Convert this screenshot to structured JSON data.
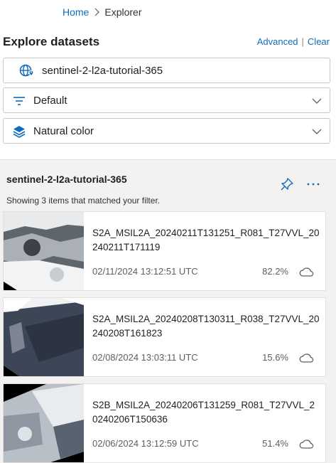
{
  "breadcrumb": {
    "home": "Home",
    "current": "Explorer"
  },
  "header": {
    "title": "Explore datasets",
    "advanced": "Advanced",
    "clear": "Clear"
  },
  "fields": {
    "dataset": {
      "value": "sentinel-2-l2a-tutorial-365",
      "icon": "globe-icon"
    },
    "filter": {
      "value": "Default",
      "icon": "filter-icon"
    },
    "render": {
      "value": "Natural color",
      "icon": "layers-icon"
    }
  },
  "results": {
    "collection": "sentinel-2-l2a-tutorial-365",
    "count_text": "Showing 3 items that matched your filter.",
    "items": [
      {
        "name": "S2A_MSIL2A_20240211T131251_R081_T27VVL_20240211T171119",
        "date": "02/11/2024 13:12:51 UTC",
        "cloud": "82.2%"
      },
      {
        "name": "S2A_MSIL2A_20240208T130311_R038_T27VVL_20240208T161823",
        "date": "02/08/2024 13:03:11 UTC",
        "cloud": "15.6%"
      },
      {
        "name": "S2B_MSIL2A_20240206T131259_R081_T27VVL_20240206T150636",
        "date": "02/06/2024 13:12:59 UTC",
        "cloud": "51.4%"
      }
    ]
  },
  "colors": {
    "accent": "#0f6cbd",
    "border": "#c8c6c4",
    "panel": "#f3f2f1"
  }
}
